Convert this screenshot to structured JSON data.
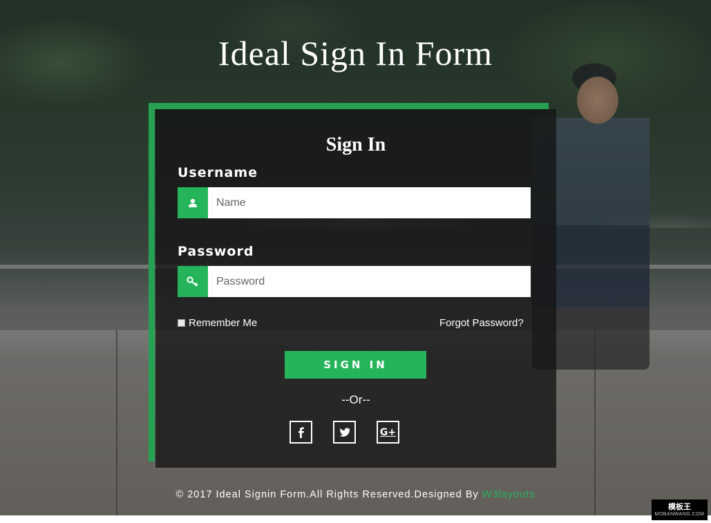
{
  "page": {
    "title": "Ideal Sign In Form"
  },
  "form": {
    "heading": "Sign In",
    "username": {
      "label": "Username",
      "placeholder": "Name",
      "value": "",
      "icon": "user-icon"
    },
    "password": {
      "label": "Password",
      "placeholder": "Password",
      "value": "",
      "icon": "key-icon"
    },
    "remember_label": "Remember Me",
    "remember_checked": false,
    "forgot_label": "Forgot Password?",
    "submit_label": "SIGN IN",
    "or_text": "--Or--",
    "social": [
      {
        "name": "facebook-icon",
        "glyph": "f"
      },
      {
        "name": "twitter-icon",
        "glyph": "twitter"
      },
      {
        "name": "google-plus-icon",
        "glyph": "G+"
      }
    ]
  },
  "footer": {
    "text": "© 2017 Ideal Signin Form.All Rights Reserved.Designed By ",
    "link_label": "W3layouts"
  },
  "watermark": {
    "main": "模板王",
    "sub": "MOBANWANG.COM"
  },
  "colors": {
    "accent": "#26b45a",
    "frame": "#26a151",
    "panel": "rgba(20,20,20,0.78)"
  }
}
